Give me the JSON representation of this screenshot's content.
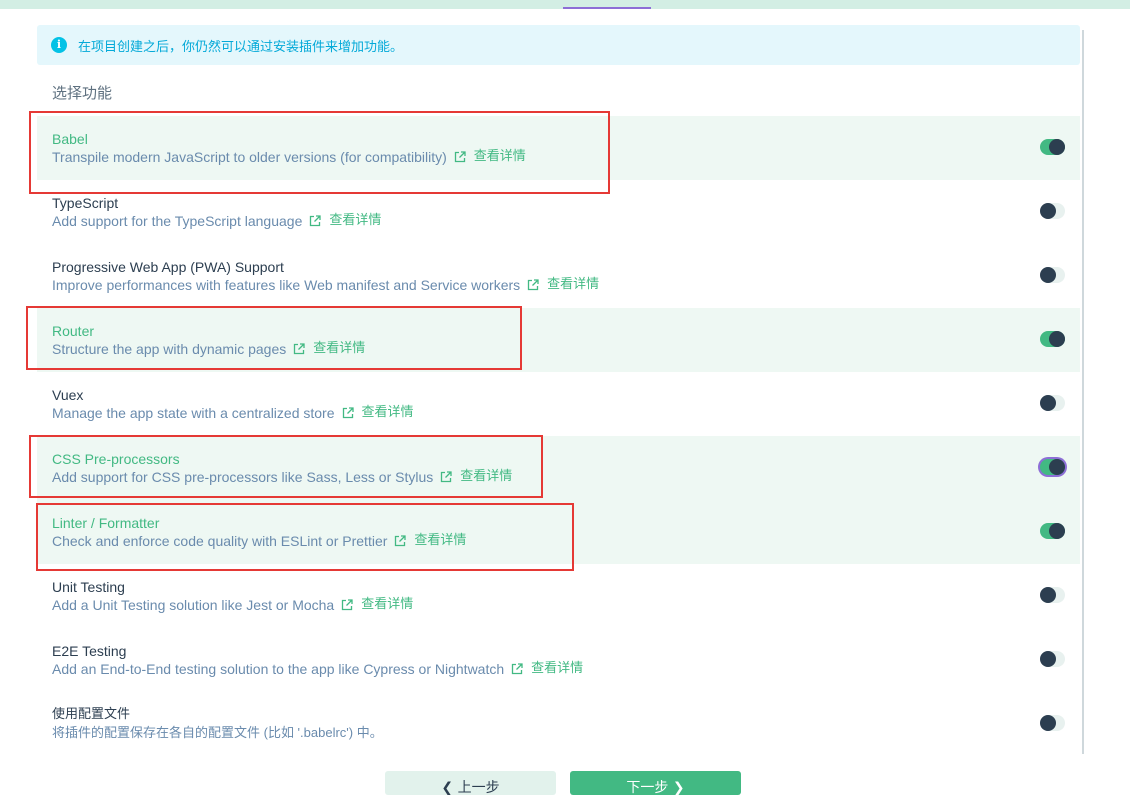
{
  "info_bar": {
    "icon": "info-icon",
    "text": "在项目创建之后，你仍然可以通过安装插件来增加功能。"
  },
  "section_title": "选择功能",
  "more_label": "查看详情",
  "features": [
    {
      "name": "Babel",
      "desc": "Transpile modern JavaScript to older versions (for compatibility)",
      "enabled": true
    },
    {
      "name": "TypeScript",
      "desc": "Add support for the TypeScript language",
      "enabled": false
    },
    {
      "name": "Progressive Web App (PWA) Support",
      "desc": "Improve performances with features like Web manifest and Service workers",
      "enabled": false
    },
    {
      "name": "Router",
      "desc": "Structure the app with dynamic pages",
      "enabled": true
    },
    {
      "name": "Vuex",
      "desc": "Manage the app state with a centralized store",
      "enabled": false
    },
    {
      "name": "CSS Pre-processors",
      "desc": "Add support for CSS pre-processors like Sass, Less or Stylus",
      "enabled": true
    },
    {
      "name": "Linter / Formatter",
      "desc": "Check and enforce code quality with ESLint or Prettier",
      "enabled": true
    },
    {
      "name": "Unit Testing",
      "desc": "Add a Unit Testing solution like Jest or Mocha",
      "enabled": false
    },
    {
      "name": "E2E Testing",
      "desc": "Add an End-to-End testing solution to the app like Cypress or Nightwatch",
      "enabled": false
    }
  ],
  "config_option": {
    "name": "使用配置文件",
    "desc": "将插件的配置保存在各自的配置文件 (比如 '.babelrc') 中。",
    "enabled": false
  },
  "buttons": {
    "prev_label": "❮  上一步",
    "next_label": "下一步  ❯"
  },
  "colors": {
    "accent": "#42b983",
    "selected_bg": "#eef8f3",
    "highlight_box": "#e53935",
    "info": "#03c2e6"
  }
}
